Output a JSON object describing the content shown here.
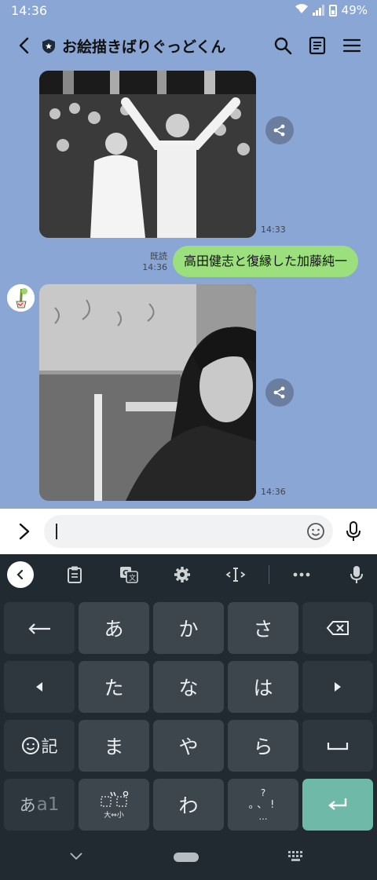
{
  "status_bar": {
    "time": "14:36",
    "network": "5",
    "battery": "49%"
  },
  "header": {
    "title": "お絵描きばりぐっどくん",
    "icons": [
      "back-arrow-icon",
      "shield-icon",
      "search-icon",
      "notes-icon",
      "menu-icon"
    ]
  },
  "messages": [
    {
      "type": "image",
      "direction": "incoming",
      "time": "14:33",
      "icon": "share-icon"
    },
    {
      "type": "text",
      "direction": "outgoing",
      "text": "高田健志と復縁した加藤純一",
      "read_label": "既読",
      "time": "14:36"
    },
    {
      "type": "image",
      "direction": "incoming",
      "time": "14:36",
      "icon": "share-icon"
    }
  ],
  "input_bar": {
    "value": "",
    "icons": [
      "expand-chevron-icon",
      "emoji-icon",
      "mic-icon"
    ]
  },
  "keyboard": {
    "toolbar": [
      "back-icon",
      "clipboard-icon",
      "translate-icon",
      "settings-icon",
      "text-cursor-icon",
      "more-icon",
      "mic-icon"
    ],
    "rows": [
      [
        "undo-arrow",
        "あ",
        "か",
        "さ",
        "backspace"
      ],
      [
        "left-arrow",
        "た",
        "な",
        "は",
        "right-arrow"
      ],
      [
        "emoji-symbol",
        "ま",
        "や",
        "ら",
        "space"
      ],
      [
        "mode-switch",
        "dakuten",
        "わ",
        "punctuation",
        "enter"
      ]
    ],
    "labels": {
      "emoji_key": "記",
      "mode_main": "あ",
      "mode_sub": "a1",
      "dakuten_sub": "大⇔小",
      "punct_top": "?",
      "punct_main": "。、!",
      "punct_bottom": "…",
      "kana_a": "あ",
      "kana_ka": "か",
      "kana_sa": "さ",
      "kana_ta": "た",
      "kana_na": "な",
      "kana_ha": "は",
      "kana_ma": "ま",
      "kana_ya": "や",
      "kana_ra": "ら",
      "kana_wa": "わ"
    }
  },
  "colors": {
    "chat_bg": "#8aa6d5",
    "bubble_out": "#9be07c",
    "keyboard_bg": "#202a30",
    "key": "#3c464c",
    "enter": "#6fb9a9"
  }
}
